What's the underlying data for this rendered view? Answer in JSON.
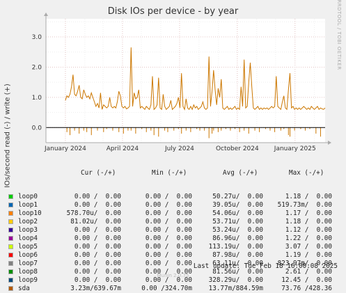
{
  "title": "Disk IOs per device - by year",
  "side_label": "RRDTOOL / TOBI OETIKER",
  "chart_data": {
    "type": "line",
    "title": "Disk IOs per device - by year",
    "ylabel": "IOs/second read (-) / write (+)",
    "xlabel": "",
    "x_ticks": [
      "January 2024",
      "April 2024",
      "July 2024",
      "October 2024",
      "January 2025"
    ],
    "y_ticks": [
      "0.0",
      "1.0",
      "2.0",
      "3.0"
    ],
    "ylim": [
      -0.5,
      3.6
    ],
    "grid": true,
    "series_colors": {
      "sda": "#cc7700"
    },
    "series": [
      {
        "name": "sda",
        "x_start": "2024-01-01",
        "x_end": "2025-02-18",
        "write_values": [
          0.9,
          1.05,
          1.0,
          1.1,
          1.35,
          1.75,
          1.1,
          1.05,
          1.2,
          1.4,
          1.0,
          0.95,
          1.25,
          1.1,
          1.0,
          1.05,
          0.95,
          1.15,
          1.0,
          0.85,
          0.7,
          0.8,
          0.65,
          1.15,
          0.6,
          0.75,
          0.7,
          0.65,
          0.7,
          1.0,
          0.7,
          0.65,
          0.7,
          0.65,
          0.85,
          1.2,
          1.05,
          0.7,
          0.65,
          0.7,
          0.62,
          0.65,
          0.7,
          2.65,
          0.7,
          1.15,
          0.95,
          1.0,
          1.25,
          0.65,
          0.7,
          0.65,
          0.6,
          0.7,
          0.65,
          0.6,
          0.75,
          1.7,
          0.6,
          0.65,
          0.75,
          1.65,
          0.65,
          0.6,
          1.1,
          0.7,
          0.6,
          0.65,
          0.7,
          0.9,
          0.6,
          0.65,
          0.7,
          0.8,
          1.0,
          0.65,
          1.8,
          0.7,
          0.6,
          0.95,
          0.65,
          0.6,
          0.7,
          0.6,
          0.75,
          0.65,
          0.7,
          0.6,
          0.65,
          0.7,
          0.85,
          0.65,
          0.6,
          0.65,
          2.35,
          0.7,
          1.2,
          1.9,
          1.25,
          0.75,
          1.3,
          1.0,
          1.6,
          0.65,
          0.6,
          0.65,
          0.7,
          0.6,
          0.65,
          0.6,
          0.65,
          0.7,
          0.6,
          0.65,
          0.6,
          1.35,
          0.7,
          2.25,
          0.65,
          0.7,
          1.5,
          2.15,
          1.35,
          0.65,
          0.6,
          0.65,
          0.7,
          0.6,
          0.65,
          0.6,
          0.65,
          0.62,
          0.65,
          0.6,
          0.65,
          0.7,
          0.65,
          0.7,
          1.7,
          0.7,
          0.65,
          0.6,
          0.85,
          1.05,
          0.65,
          0.6,
          1.25,
          1.8,
          0.65,
          0.7,
          0.6,
          0.65,
          0.6,
          0.65,
          0.6,
          0.65,
          0.7,
          0.65,
          0.6,
          0.65,
          0.6,
          0.7,
          0.65,
          0.6,
          0.65,
          0.7,
          0.6,
          0.65,
          0.62,
          0.6,
          0.65
        ],
        "read_values": [
          0.0,
          -0.15,
          0.0,
          -0.25,
          0.0,
          0.0,
          -0.1,
          0.0,
          0.0,
          -0.2,
          0.0,
          0.0,
          -0.1,
          0.0,
          -0.15,
          0.0,
          0.0,
          -0.25,
          0.0,
          0.0,
          0.0,
          -0.1,
          0.0,
          0.0,
          0.0,
          -0.15,
          0.0,
          -0.05,
          0.0,
          0.0,
          0.0,
          -0.1,
          0.0,
          0.0,
          0.0,
          -0.15,
          0.0,
          0.0,
          -0.2,
          0.0,
          0.0,
          -0.1,
          0.0,
          -0.1,
          0.0,
          0.0,
          -0.2,
          0.0,
          0.0,
          0.0,
          -0.05,
          0.0,
          0.0,
          -0.15,
          0.0,
          0.0,
          -0.1,
          0.0,
          -0.25,
          0.0,
          0.0,
          -0.3,
          0.0,
          0.0,
          0.0,
          -0.1,
          0.0,
          -0.15,
          0.0,
          0.0,
          0.0,
          -0.1,
          0.0,
          0.0,
          -0.05,
          0.0,
          -0.2,
          0.0,
          0.0,
          -0.1,
          0.0,
          0.0,
          -0.15,
          0.0,
          0.0,
          0.0,
          -0.05,
          0.0,
          -0.1,
          0.0,
          0.0,
          -0.1,
          0.0,
          0.0,
          -0.35,
          0.0,
          -0.2,
          -0.1,
          0.0,
          0.0,
          -0.15,
          0.0,
          -0.1,
          0.0,
          0.0,
          -0.05,
          0.0,
          0.0,
          -0.1,
          0.0,
          0.0,
          -0.05,
          0.0,
          0.0,
          -0.15,
          0.0,
          0.0,
          -0.1,
          0.0,
          0.0,
          -0.2,
          0.0,
          0.0,
          0.0,
          -0.1,
          0.0,
          0.0,
          -0.15,
          0.0,
          0.0,
          0.0,
          -0.05,
          0.0,
          0.0,
          -0.1,
          0.0,
          0.0,
          -0.15,
          0.0,
          0.0,
          0.0,
          -0.1,
          0.0,
          -0.05,
          0.0,
          0.0,
          -0.25,
          -0.3,
          0.0,
          0.0,
          -0.1,
          0.0,
          0.0,
          0.0,
          -0.05,
          0.0,
          0.0,
          -0.1,
          0.0,
          0.0,
          -0.05,
          0.0,
          0.0,
          0.0,
          -0.2,
          0.0,
          0.0,
          -0.3,
          0.0,
          0.0,
          0.0
        ]
      }
    ]
  },
  "legend": {
    "header": {
      "cur": "Cur (-/+)",
      "min": "Min (-/+)",
      "avg": "Avg (-/+)",
      "max": "Max (-/+)"
    },
    "rows": [
      {
        "name": "loop0",
        "color": "#00cc00",
        "cur": "0.00 /  0.00",
        "min": "0.00 /  0.00",
        "avg": "50.27u/  0.00",
        "max": "1.18 /  0.00"
      },
      {
        "name": "loop1",
        "color": "#0066b3",
        "cur": "0.00 /  0.00",
        "min": "0.00 /  0.00",
        "avg": "39.05u/  0.00",
        "max": "519.73m/  0.00"
      },
      {
        "name": "loop10",
        "color": "#ff8000",
        "cur": "578.70u/  0.00",
        "min": "0.00 /  0.00",
        "avg": "54.06u/  0.00",
        "max": "1.17 /  0.00"
      },
      {
        "name": "loop2",
        "color": "#ffcc00",
        "cur": "81.02u/  0.00",
        "min": "0.00 /  0.00",
        "avg": "53.71u/  0.00",
        "max": "1.18 /  0.00"
      },
      {
        "name": "loop3",
        "color": "#330099",
        "cur": "0.00 /  0.00",
        "min": "0.00 /  0.00",
        "avg": "53.24u/  0.00",
        "max": "1.12 /  0.00"
      },
      {
        "name": "loop4",
        "color": "#990099",
        "cur": "0.00 /  0.00",
        "min": "0.00 /  0.00",
        "avg": "86.96u/  0.00",
        "max": "1.22 /  0.00"
      },
      {
        "name": "loop5",
        "color": "#ccff00",
        "cur": "0.00 /  0.00",
        "min": "0.00 /  0.00",
        "avg": "113.19u/  0.00",
        "max": "3.07 /  0.00"
      },
      {
        "name": "loop6",
        "color": "#ff0000",
        "cur": "0.00 /  0.00",
        "min": "0.00 /  0.00",
        "avg": "87.98u/  0.00",
        "max": "1.19 /  0.00"
      },
      {
        "name": "loop7",
        "color": "#808080",
        "cur": "0.00 /  0.00",
        "min": "0.00 /  0.00",
        "avg": "63.11u/  0.00",
        "max": "823.97m/  0.00"
      },
      {
        "name": "loop8",
        "color": "#008f00",
        "cur": "0.00 /  0.00",
        "min": "0.00 /  0.00",
        "avg": "81.56u/  0.00",
        "max": "2.61 /  0.00"
      },
      {
        "name": "loop9",
        "color": "#00487d",
        "cur": "0.00 /  0.00",
        "min": "0.00 /  0.00",
        "avg": "328.29u/  0.00",
        "max": "12.45 /  0.00"
      },
      {
        "name": "sda",
        "color": "#b35a00",
        "cur": "3.23m/639.67m",
        "min": "0.00 /324.70m",
        "avg": "13.77m/884.59m",
        "max": "73.76 /428.36"
      }
    ]
  },
  "last_update": "Last update: Tue Feb 18 16:00:08 2025",
  "footer": "Munin 2.0.75"
}
